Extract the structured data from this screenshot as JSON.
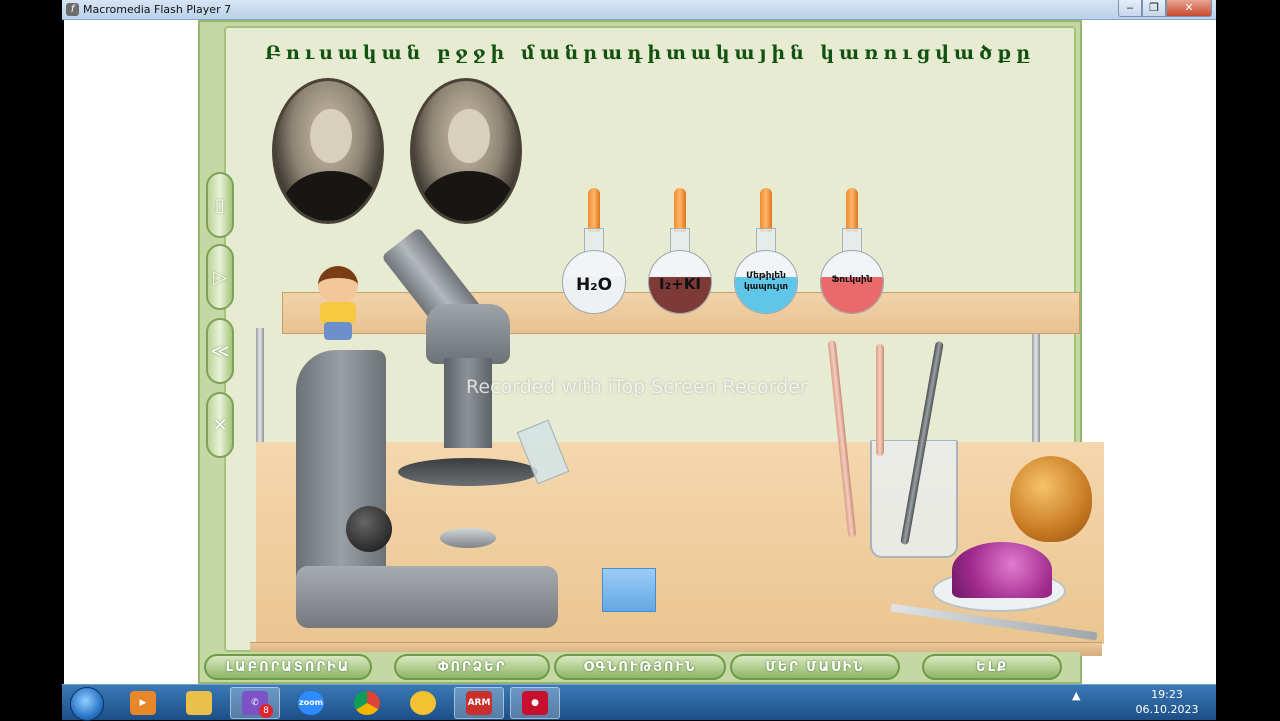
{
  "window": {
    "title": "Macromedia Flash Player 7",
    "controls": {
      "minimize": "‒",
      "maximize": "❐",
      "close": "✕"
    }
  },
  "lesson": {
    "title": "Բուսական բջջի մանրադիտակային կառուցվածքը",
    "side_buttons": [
      {
        "name": "pause",
        "glyph": "▯"
      },
      {
        "name": "play",
        "glyph": "▷"
      },
      {
        "name": "rewind",
        "glyph": "≪"
      },
      {
        "name": "close",
        "glyph": "✕"
      }
    ],
    "flasks": [
      {
        "label": "H₂O",
        "color": "#eef1f3"
      },
      {
        "label": "I₂+KI",
        "color": "#7e3a36"
      },
      {
        "label": "Մեթիլեն կապույտ",
        "color": "#5fc6e8"
      },
      {
        "label": "Ֆուկսին",
        "color": "#e86a6a"
      }
    ],
    "watermark": "Recorded with iTop Screen Recorder",
    "nav": [
      "ԼԱԲՈՐԱՏՈՐԻԱ",
      "ՓՈՐՁԵՐ",
      "ՕԳՆՈՒԹՅՈՒՆ",
      "ՄԵՐ ՄԱՍԻՆ",
      "ԵԼՔ"
    ]
  },
  "taskbar": {
    "apps": [
      {
        "name": "windows-media-player",
        "label": "▶",
        "color": "#e8862a"
      },
      {
        "name": "file-explorer",
        "label": "",
        "color": "#e8c04a"
      },
      {
        "name": "viber",
        "label": "✆",
        "color": "#7d52c7",
        "badge": "8"
      },
      {
        "name": "zoom",
        "label": "zoom",
        "color": "#2d8cff"
      },
      {
        "name": "chrome",
        "label": "",
        "color": "#db4437"
      },
      {
        "name": "app-lemon",
        "label": "",
        "color": "#f2c233"
      },
      {
        "name": "app-arm",
        "label": "ARM",
        "color": "#c9302c"
      },
      {
        "name": "screen-recorder",
        "label": "●",
        "color": "#c8102e"
      }
    ],
    "clock": {
      "time": "19:23",
      "date": "06.10.2023"
    },
    "tray": "▲"
  },
  "colors": {
    "frame": "#c5d7a3",
    "title_text": "#12510f",
    "taskbar": "#1d4f86"
  }
}
